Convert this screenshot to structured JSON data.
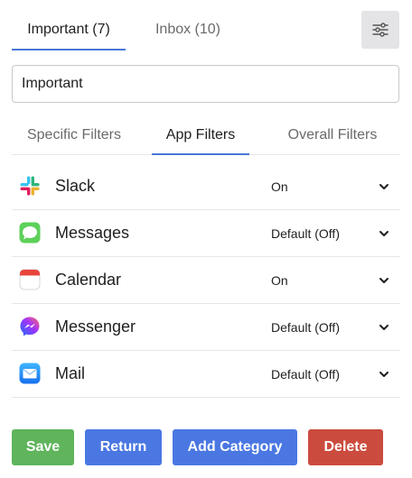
{
  "top_tabs": [
    {
      "label": "Important (7)",
      "active": true
    },
    {
      "label": "Inbox (10)",
      "active": false
    }
  ],
  "settings": {
    "icon": "sliders-icon"
  },
  "category_name": {
    "value": "Important"
  },
  "filter_tabs": [
    {
      "label": "Specific Filters",
      "active": false
    },
    {
      "label": "App Filters",
      "active": true
    },
    {
      "label": "Overall Filters",
      "active": false
    }
  ],
  "apps": [
    {
      "name": "Slack",
      "status": "On",
      "icon": "slack-icon"
    },
    {
      "name": "Messages",
      "status": "Default (Off)",
      "icon": "messages-icon"
    },
    {
      "name": "Calendar",
      "status": "On",
      "icon": "calendar-icon"
    },
    {
      "name": "Messenger",
      "status": "Default (Off)",
      "icon": "messenger-icon"
    },
    {
      "name": "Mail",
      "status": "Default (Off)",
      "icon": "mail-icon"
    }
  ],
  "buttons": {
    "save": "Save",
    "return": "Return",
    "add_category": "Add Category",
    "delete": "Delete"
  },
  "colors": {
    "accent": "#4a77d8",
    "save": "#5fb45c",
    "primary": "#4a77e2",
    "danger": "#cb4b3e"
  }
}
